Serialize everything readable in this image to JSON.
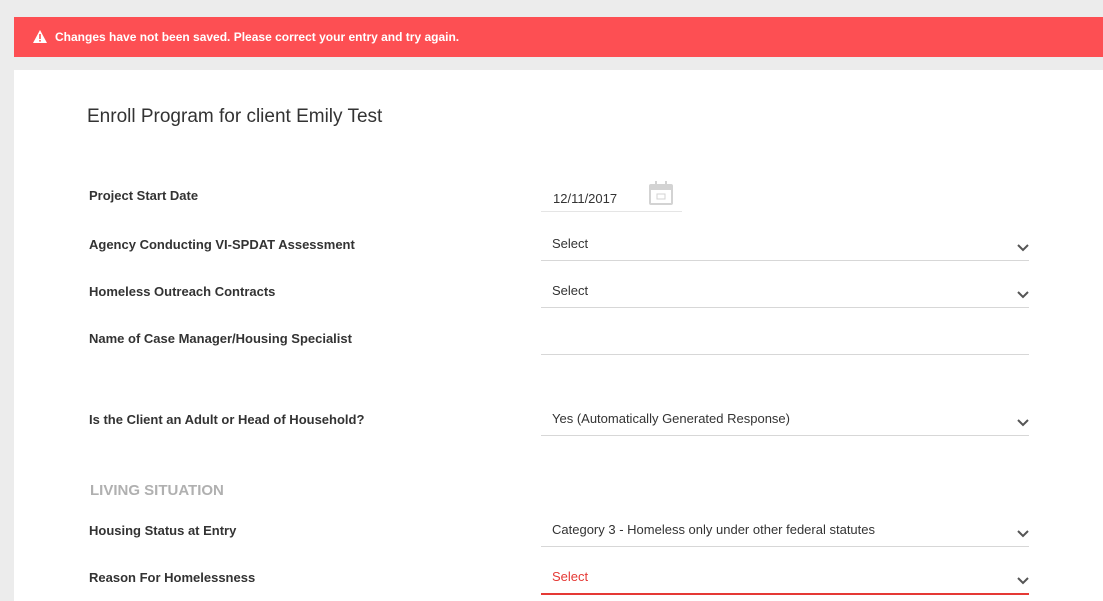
{
  "alert": {
    "message": "Changes have not been saved. Please correct your entry and try again.",
    "icon": "warning-icon",
    "color": "#fd4f53"
  },
  "form": {
    "title": "Enroll Program for client Emily Test",
    "fields": [
      {
        "label": "Project Start Date",
        "value": "12/11/2017",
        "type": "date"
      },
      {
        "label": "Agency Conducting VI-SPDAT Assessment",
        "value": "Select",
        "type": "select"
      },
      {
        "label": "Homeless Outreach Contracts",
        "value": "Select",
        "type": "select"
      },
      {
        "label": "Name of Case Manager/Housing Specialist",
        "value": "",
        "type": "text"
      },
      {
        "label": "Is the Client an Adult or Head of Household?",
        "value": "Yes (Automatically Generated Response)",
        "type": "select"
      }
    ],
    "section": {
      "title": "LIVING SITUATION",
      "fields": [
        {
          "label": "Housing Status at Entry",
          "value": "Category 3 - Homeless only under other federal statutes",
          "type": "select"
        },
        {
          "label": "Reason For Homelessness",
          "value": "Select",
          "type": "select",
          "error": true
        }
      ]
    }
  },
  "colors": {
    "error": "#e53935",
    "section_heading": "#b0b0b0"
  }
}
